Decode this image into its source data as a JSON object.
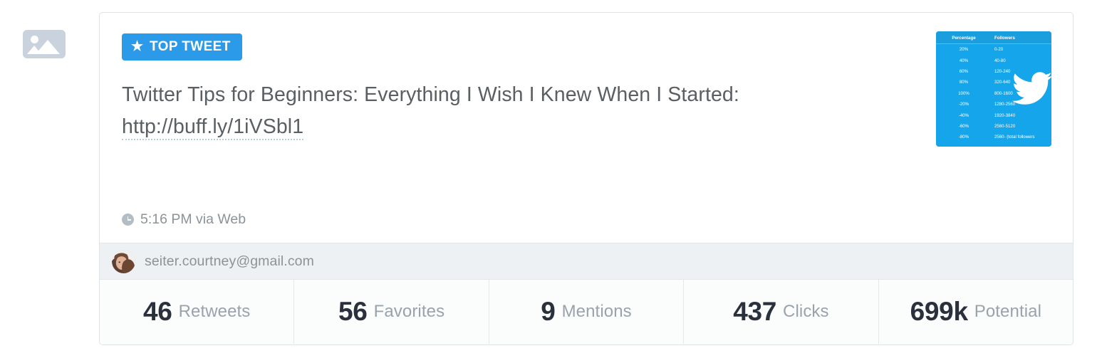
{
  "placeholder": {
    "icon": "broken-image-icon"
  },
  "card": {
    "badge": {
      "icon": "star-icon",
      "label": "TOP TWEET"
    },
    "tweet": {
      "text": "Twitter Tips for Beginners: Everything I Wish I Knew When I Started:",
      "link": "http://buff.ly/1iVSbl1"
    },
    "meta": {
      "icon": "clock-icon",
      "text": "5:16 PM via Web"
    },
    "thumbnail": {
      "alt": "tweet-image-thumbnail",
      "bird_icon": "twitter-bird-icon",
      "headers": [
        "Percentage",
        "Followers"
      ],
      "rows": [
        {
          "percentage": "20%",
          "followers": "0-20"
        },
        {
          "percentage": "40%",
          "followers": "40-80"
        },
        {
          "percentage": "60%",
          "followers": "120-240"
        },
        {
          "percentage": "80%",
          "followers": "320-640"
        },
        {
          "percentage": "100%",
          "followers": "800-1600"
        },
        {
          "percentage": "-20%",
          "followers": "1280-2560"
        },
        {
          "percentage": "-40%",
          "followers": "1920-3840"
        },
        {
          "percentage": "-60%",
          "followers": "2560-5120"
        },
        {
          "percentage": "-80%",
          "followers": "2560- (total followers"
        }
      ]
    },
    "account": {
      "avatar": "user-avatar",
      "email": "seiter.courtney@gmail.com"
    },
    "stats": [
      {
        "value": "46",
        "label": "Retweets"
      },
      {
        "value": "56",
        "label": "Favorites"
      },
      {
        "value": "9",
        "label": "Mentions"
      },
      {
        "value": "437",
        "label": "Clicks"
      },
      {
        "value": "699k",
        "label": "Potential"
      }
    ]
  },
  "colors": {
    "badge_blue": "#2b9ae8",
    "thumb_blue": "#15a5ea",
    "text_gray": "#5a5f63",
    "muted_gray": "#8b9399",
    "stat_value": "#2a313c",
    "stat_label": "#9aa3ab",
    "card_border": "#dfe3e6",
    "account_bg": "#eef1f4"
  }
}
